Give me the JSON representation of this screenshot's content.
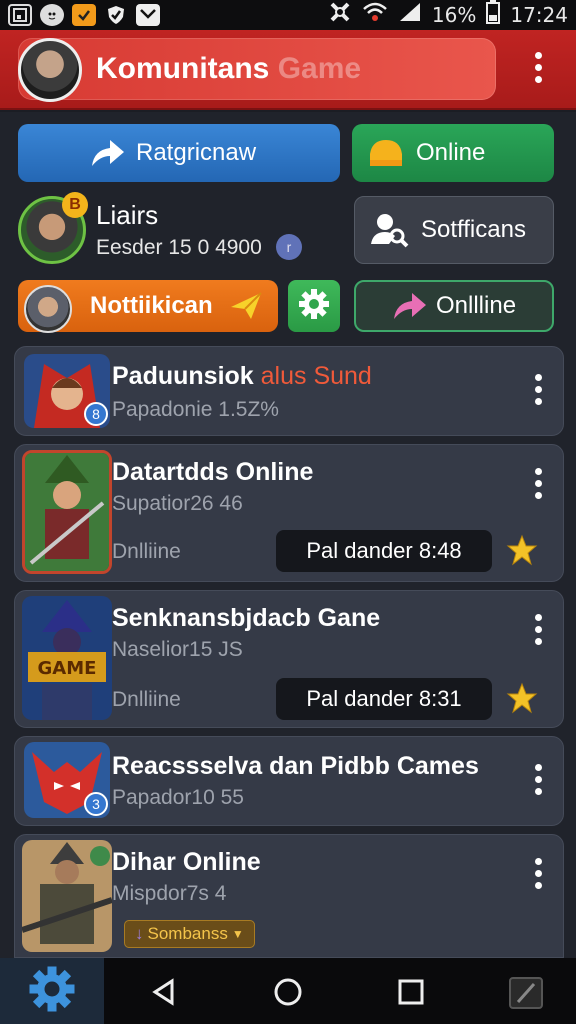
{
  "status_bar": {
    "battery": "16%",
    "time": "17:24",
    "icons": [
      "gallery-icon",
      "cat-icon",
      "checkbox-orange-icon",
      "shield-icon",
      "mail-icon",
      "sync-icon",
      "wifi-icon",
      "signal-icon",
      "battery-icon"
    ]
  },
  "header": {
    "title": "Komunitans",
    "title_faded": "Game",
    "avatar_icon": "soldier-avatar",
    "menu_icon": "kebab-menu-icon"
  },
  "actions": {
    "primary_label": "Ratgricnaw",
    "online_label": "Online",
    "search_label": "Sotfficans",
    "notify_label": "Nottiikican",
    "online2_label": "Onllline"
  },
  "user": {
    "name": "Liairs",
    "stats": "Eesder 15  0 4900",
    "badge": "B",
    "dot": "r"
  },
  "games": [
    {
      "title": "Paduunsiok",
      "title_accent": "alus Sund",
      "subtitle": "Papadonie 1.5Z%",
      "badge": "8"
    },
    {
      "title": "Datartdds Online",
      "subtitle": "Supatior26 46",
      "status": "Dnlliine",
      "pill": "Pal dander 8:48"
    },
    {
      "title": "Senknansbjdacb Gane",
      "subtitle": "Naselior15 JS",
      "status": "Dnlliine",
      "pill": "Pal dander 8:31"
    },
    {
      "title": "Reacssselva dan Pidbb Cames",
      "subtitle": "Papador10 55",
      "badge": "3"
    },
    {
      "title": "Dihar Online",
      "subtitle": "Mispdor7s 4",
      "tag": "Sombanss"
    }
  ],
  "colors": {
    "header_red": "#c02422",
    "accent_blue": "#2f79c8",
    "accent_green": "#24984f",
    "accent_orange": "#e86f17",
    "card_bg": "#353a47"
  }
}
